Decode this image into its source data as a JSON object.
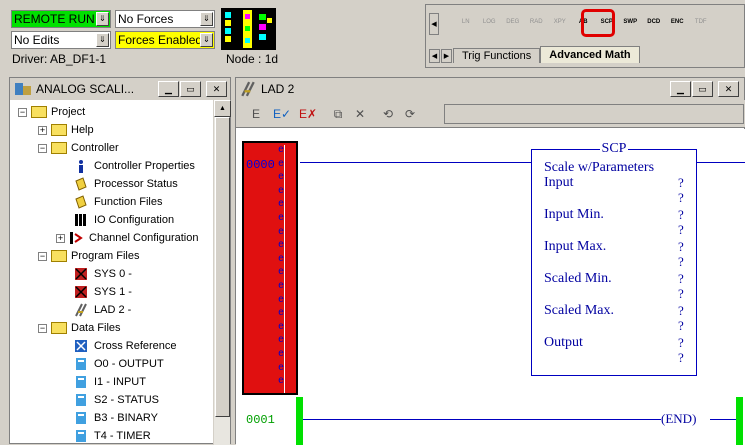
{
  "status": {
    "mode": "REMOTE RUN",
    "forces": "No Forces",
    "edits": "No Edits",
    "forces_enabled": "Forces Enabled",
    "driver": "Driver: AB_DF1-1",
    "node": "Node :  1d"
  },
  "instructions": {
    "items": [
      "LN",
      "LOG",
      "DEG",
      "RAD",
      "XPY",
      "AB",
      "SCP",
      "SWP",
      "DCD",
      "ENC",
      "TDF"
    ],
    "tabs": [
      "Trig Functions",
      "Advanced Math"
    ],
    "active_tab": "Advanced Math",
    "highlight": "SCP"
  },
  "project_window": {
    "title": "ANALOG SCALI...",
    "tree": [
      {
        "label": "Project",
        "icon": "folder-icon",
        "expander": "-"
      },
      {
        "label": "Help",
        "icon": "folder-icon",
        "expander": "+"
      },
      {
        "label": "Controller",
        "icon": "folder-icon",
        "expander": "-"
      },
      {
        "label": "Controller Properties",
        "icon": "info-icon"
      },
      {
        "label": "Processor Status",
        "icon": "status-icon"
      },
      {
        "label": "Function Files",
        "icon": "function-files-icon"
      },
      {
        "label": "IO Configuration",
        "icon": "io-config-icon"
      },
      {
        "label": "Channel Configuration",
        "icon": "channel-config-icon",
        "expander": "+"
      },
      {
        "label": "Program Files",
        "icon": "folder-icon",
        "expander": "-"
      },
      {
        "label": "SYS 0 -",
        "icon": "program-file-icon"
      },
      {
        "label": "SYS 1 -",
        "icon": "program-file-icon"
      },
      {
        "label": "LAD 2 -",
        "icon": "ladder-file-icon"
      },
      {
        "label": "Data Files",
        "icon": "folder-icon",
        "expander": "-"
      },
      {
        "label": "Cross Reference",
        "icon": "cross-reference-icon"
      },
      {
        "label": "O0 - OUTPUT",
        "icon": "data-file-icon"
      },
      {
        "label": "I1 - INPUT",
        "icon": "data-file-icon"
      },
      {
        "label": "S2 - STATUS",
        "icon": "data-file-icon"
      },
      {
        "label": "B3 - BINARY",
        "icon": "data-file-icon"
      },
      {
        "label": "T4 - TIMER",
        "icon": "data-file-icon"
      }
    ]
  },
  "ladder_window": {
    "title": "LAD 2",
    "rungs": [
      "0000",
      "0001"
    ],
    "scp": {
      "title": "SCP",
      "description": "Scale w/Parameters",
      "params": [
        "Input",
        "Input Min.",
        "Input Max.",
        "Scaled Min.",
        "Scaled Max.",
        "Output"
      ],
      "placeholder": "?"
    },
    "end_label": "END",
    "rung_marker": "e"
  },
  "colors": {
    "run_green": "#00e000",
    "forces_yellow": "#ffff00",
    "rung_error_red": "#e01010",
    "ladder_blue": "#0000c0",
    "highlight_red": "#e00000"
  }
}
